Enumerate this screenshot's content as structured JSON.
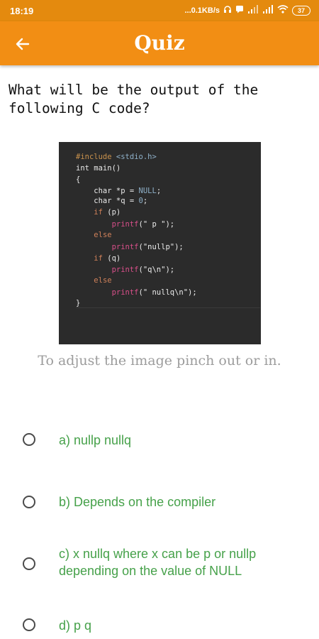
{
  "status_bar": {
    "time": "18:19",
    "net_speed": "...0.1KB/s",
    "battery": "37"
  },
  "app_bar": {
    "title": "Quiz",
    "back_icon": "arrow-left-icon"
  },
  "question": "What will be the output of the following C code?",
  "code_image": {
    "lines": [
      "#include <stdio.h>",
      "int main()",
      "{",
      "    char *p = NULL;",
      "    char *q = 0;",
      "    if (p)",
      "        printf(\" p \");",
      "    else",
      "        printf(\"nullp\");",
      "    if (q)",
      "        printf(\"q\\n\");",
      "    else",
      "        printf(\" nullq\\n\");",
      "}"
    ]
  },
  "hint": "To adjust the image pinch out or in.",
  "options": [
    {
      "label": "a) nullp nullq"
    },
    {
      "label": "b) Depends on the compiler"
    },
    {
      "label": "c) x nullq where x can be p or nullp depending on the value of NULL"
    },
    {
      "label": "d) p q"
    }
  ],
  "colors": {
    "app_bar": "#f28e14",
    "status_bar": "#e48a0e",
    "option_text": "#46a14a",
    "hint_text": "#9c9c9c"
  }
}
